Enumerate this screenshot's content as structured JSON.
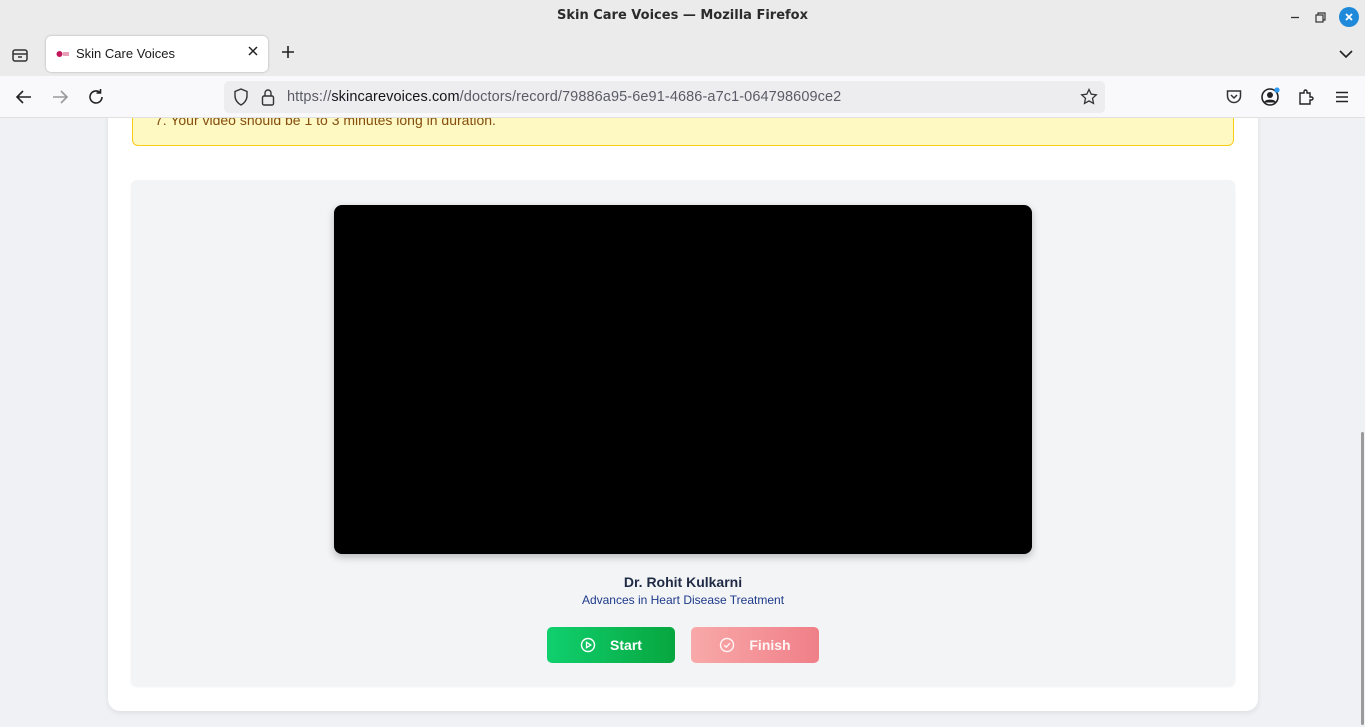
{
  "window": {
    "title": "Skin Care Voices — Mozilla Firefox"
  },
  "tabs": [
    {
      "label": "Skin Care Voices",
      "active": true
    }
  ],
  "navbar": {
    "url_scheme": "https://",
    "url_host": "skincarevoices.com",
    "url_path": "/doctors/record/79886a95-6e91-4686-a7c1-064798609ce2"
  },
  "page": {
    "notice_text": "7. Your video should be 1 to 3 minutes long in duration.",
    "doctor_name": "Dr. Rohit Kulkarni",
    "doctor_topic": "Advances in Heart Disease Treatment",
    "start_label": "Start",
    "finish_label": "Finish"
  },
  "icons": {
    "tab_list": "tab-list-icon",
    "favicon": "site-favicon",
    "tab_close": "close-icon",
    "new_tab": "plus-icon",
    "overflow": "chevron-down-icon",
    "back": "back-arrow-icon",
    "forward": "forward-arrow-icon",
    "reload": "reload-icon",
    "shield": "shield-icon",
    "lock": "lock-icon",
    "bookmark": "star-icon",
    "pocket": "pocket-icon",
    "account": "account-icon",
    "extensions": "puzzle-icon",
    "menu": "hamburger-menu-icon",
    "play": "play-circle-icon",
    "check": "check-circle-icon"
  },
  "colors": {
    "start_button": "#07a63f",
    "finish_button": "#f07f88",
    "notice_bg": "#fef9c3",
    "notice_text": "#854d0e"
  }
}
